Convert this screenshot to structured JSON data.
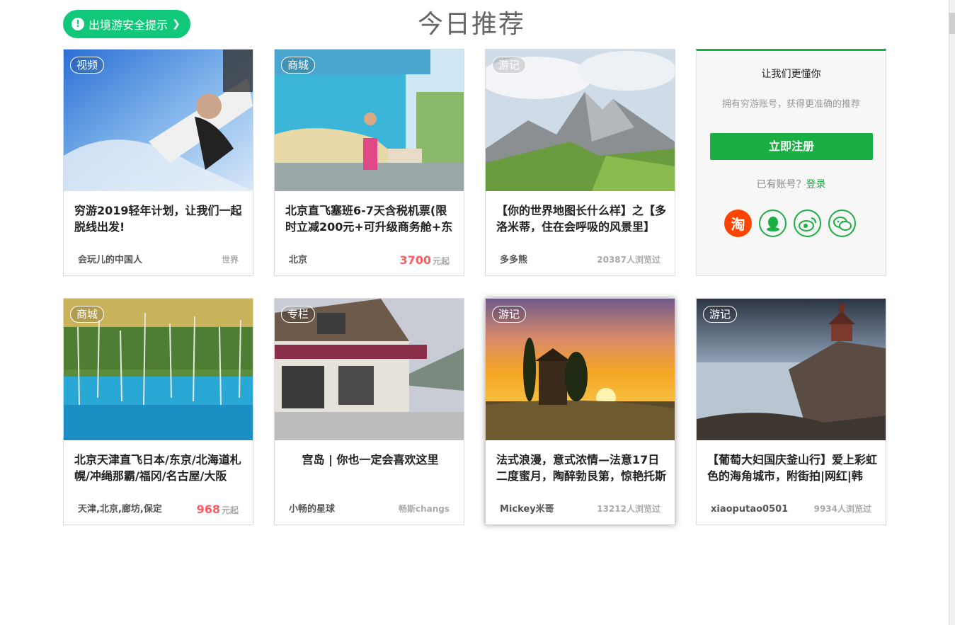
{
  "header": {
    "safety_tip": "出境游安全提示",
    "page_title": "今日推荐"
  },
  "cards_row1": [
    {
      "tag": "视频",
      "title": "穷游2019轻年计划，让我们一起脱线出发!",
      "author": "会玩儿的中国人",
      "meta": "世界"
    },
    {
      "tag": "商城",
      "title": "北京直飞塞班6-7天含税机票(限时立减200元+可升级商务舱+东",
      "author": "北京",
      "price": "3700",
      "price_unit": "元起"
    },
    {
      "tag": "游记",
      "title": "【你的世界地图长什么样】之【多洛米蒂，住在会呼吸的风景里】",
      "author": "多多熊",
      "meta": "20387人浏览过"
    }
  ],
  "login": {
    "heading": "让我们更懂你",
    "sub": "拥有穷游账号，获得更准确的推荐",
    "register": "立即注册",
    "have_account": "已有账号？",
    "login_link": "登录",
    "taobao_glyph": "淘"
  },
  "cards_row2": [
    {
      "tag": "商城",
      "title": "北京天津直飞日本/东京/北海道札幌/冲绳那霸/福冈/名古屋/大阪",
      "author": "天津,北京,廊坊,保定",
      "price": "968",
      "price_unit": "元起"
    },
    {
      "tag": "专栏",
      "title": "宫岛 | 你也一定会喜欢这里",
      "author": "小畅的星球",
      "meta": "畅斯changs"
    },
    {
      "tag": "游记",
      "title": "法式浪漫，意式浓情—法意17日二度蜜月，陶醉勃艮第，惊艳托斯",
      "author": "Mickey米哥",
      "meta": "13212人浏览过"
    },
    {
      "tag": "游记",
      "title": "【葡萄大妇国庆釜山行】爱上彩虹色的海角城市，附街拍|网红|韩",
      "author": "xiaoputao0501",
      "meta": "9934人浏览过"
    }
  ],
  "colors": {
    "accent": "#1aaf43",
    "safety": "#11c87a",
    "price": "#ff5a5f"
  }
}
